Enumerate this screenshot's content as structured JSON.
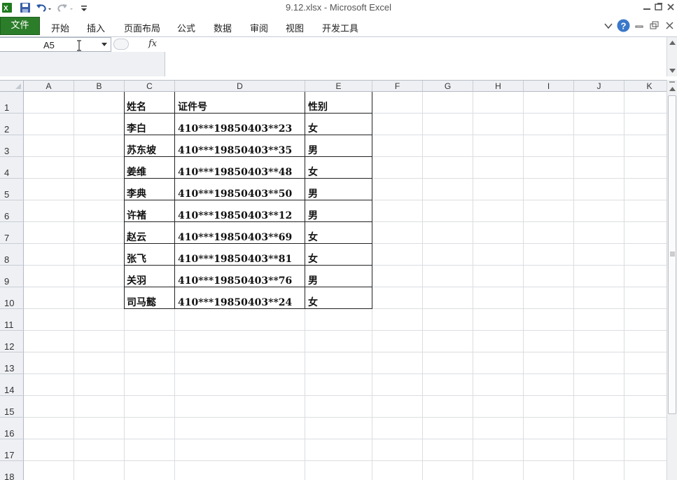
{
  "window": {
    "title": "9.12.xlsx  -  Microsoft Excel"
  },
  "ribbon": {
    "file_tab": "文件",
    "tabs": [
      "开始",
      "插入",
      "页面布局",
      "公式",
      "数据",
      "审阅",
      "视图",
      "开发工具"
    ]
  },
  "formula_bar": {
    "name_box": "A5",
    "fx_label": "fx",
    "formula": ""
  },
  "sheet": {
    "columns": [
      "A",
      "B",
      "C",
      "D",
      "E",
      "F",
      "G",
      "H",
      "I",
      "J",
      "K"
    ],
    "rows": [
      "1",
      "2",
      "3",
      "4",
      "5",
      "6",
      "7",
      "8",
      "9",
      "10",
      "11",
      "12",
      "13",
      "14",
      "15",
      "16",
      "17",
      "18"
    ],
    "table": {
      "headers": [
        "姓名",
        "证件号",
        "性别"
      ],
      "records": [
        [
          "李白",
          "410***19850403**23",
          "女"
        ],
        [
          "苏东坡",
          "410***19850403**35",
          "男"
        ],
        [
          "姜维",
          "410***19850403**48",
          "女"
        ],
        [
          "李典",
          "410***19850403**50",
          "男"
        ],
        [
          "许褚",
          "410***19850403**12",
          "男"
        ],
        [
          "赵云",
          "410***19850403**69",
          "女"
        ],
        [
          "张飞",
          "410***19850403**81",
          "女"
        ],
        [
          "关羽",
          "410***19850403**76",
          "男"
        ],
        [
          "司马懿",
          "410***19850403**24",
          "女"
        ]
      ]
    }
  },
  "colors": {
    "file_tab": "#2c7d2a",
    "header_bg": "#eef0f3",
    "grid_line": "#dadde1"
  },
  "icons": [
    "excel-logo-icon",
    "save-icon",
    "undo-icon",
    "redo-icon",
    "customize-toolbar-icon",
    "help-icon",
    "minimize-ribbon-icon",
    "minimize-icon",
    "restore-icon",
    "close-icon"
  ]
}
